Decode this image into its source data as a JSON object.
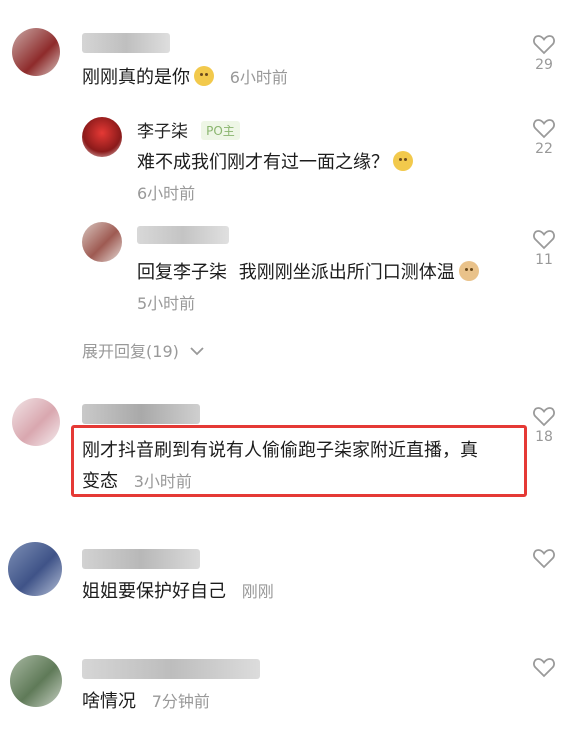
{
  "comments": [
    {
      "text": "刚刚真的是你",
      "time": "6小时前",
      "likes": "29"
    },
    {
      "author": "李子柒",
      "badge": "PO主",
      "text": "难不成我们刚才有过一面之缘？",
      "time": "6小时前",
      "likes": "22"
    },
    {
      "reply_prefix": "回复",
      "reply_target": "李子柒",
      "text": "我刚刚坐派出所门口测体温",
      "time": "5小时前",
      "likes": "11"
    },
    {
      "text_line1": "刚才抖音刷到有说有人偷偷跑子柒家附近直播，真",
      "text_line2": "变态",
      "time": "3小时前",
      "likes": "18"
    },
    {
      "text": "姐姐要保护好自己",
      "time": "刚刚"
    },
    {
      "text": "啥情况",
      "time": "7分钟前"
    }
  ],
  "expand_replies": {
    "label": "展开回复",
    "count": "(19)"
  },
  "icons": {
    "like": "heart-outline-icon",
    "expand": "chevron-down-icon",
    "emoji_doge": "doge-emoji-icon",
    "emoji_cat": "cat-emoji-icon"
  },
  "colors": {
    "highlight_border": "#e53935",
    "secondary_text": "#999999",
    "badge": "#8ab56e"
  }
}
